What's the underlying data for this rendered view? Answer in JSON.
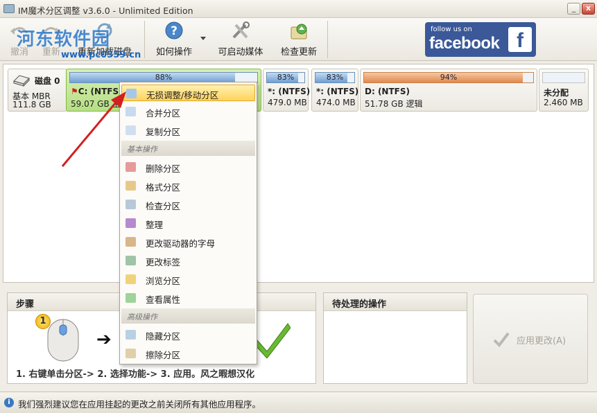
{
  "window": {
    "title": "IM魔术分区调整 v3.6.0 - Unlimited Edition",
    "minimize_label": "_",
    "close_label": "x"
  },
  "watermark": {
    "name": "河东软件园",
    "url": "www.pc0359.cn"
  },
  "toolbar": {
    "undo_label": "撤消",
    "redo_label": "重新",
    "reload_label": "重新加载磁盘",
    "help_label": "如何操作",
    "bootable_label": "可启动媒体",
    "update_label": "检查更新",
    "facebook_follow": "follow us on",
    "facebook_brand": "facebook",
    "facebook_f": "f"
  },
  "disk": {
    "title": "磁盘 0",
    "type": "基本 MBR",
    "size": "111.8 GB"
  },
  "partitions": [
    {
      "usage": "88%",
      "usage_fraction": 0.88,
      "name": "C: (NTFS)",
      "info": "59.07 GB 主要",
      "flag_icon": "flag-icon"
    },
    {
      "usage": "83%",
      "usage_fraction": 0.83,
      "name": "*: (NTFS)",
      "info": "479.0 MB"
    },
    {
      "usage": "83%",
      "usage_fraction": 0.83,
      "name": "*: (NTFS)",
      "info": "474.0 MB"
    },
    {
      "usage": "94%",
      "usage_fraction": 0.94,
      "name": "D: (NTFS)",
      "info": "51.78 GB 逻辑"
    },
    {
      "usage": "",
      "usage_fraction": 0,
      "name": "未分配",
      "info": "2.460 MB"
    }
  ],
  "context_menu": {
    "items_top": [
      "无损调整/移动分区",
      "合并分区",
      "复制分区"
    ],
    "basic_header": "基本操作",
    "items_basic": [
      "删除分区",
      "格式分区",
      "检查分区",
      "整理",
      "更改驱动器的字母",
      "更改标签",
      "浏览分区",
      "查看属性"
    ],
    "advanced_header": "高级操作",
    "items_advanced": [
      "隐藏分区",
      "擦除分区"
    ]
  },
  "steps_panel": {
    "title": "步骤",
    "step_number": "1",
    "step_arrow": "➔",
    "instructions": "1. 右键单击分区-> 2. 选择功能-> 3. 应用。风之暇想汉化"
  },
  "pending_panel": {
    "title": "待处理的操作"
  },
  "apply_button": {
    "label": "应用更改(A)"
  },
  "status": {
    "icon_glyph": "i",
    "message": "我们强烈建议您在应用挂起的更改之前关闭所有其他应用程序。"
  },
  "colors": {
    "selected_partition": "#b6df84",
    "usage_blue": "#6f9fd2",
    "usage_orange": "#e08a4c",
    "menu_highlight": "#ffd35c",
    "facebook_blue": "#3b5998",
    "arrow_red": "#d22020"
  }
}
